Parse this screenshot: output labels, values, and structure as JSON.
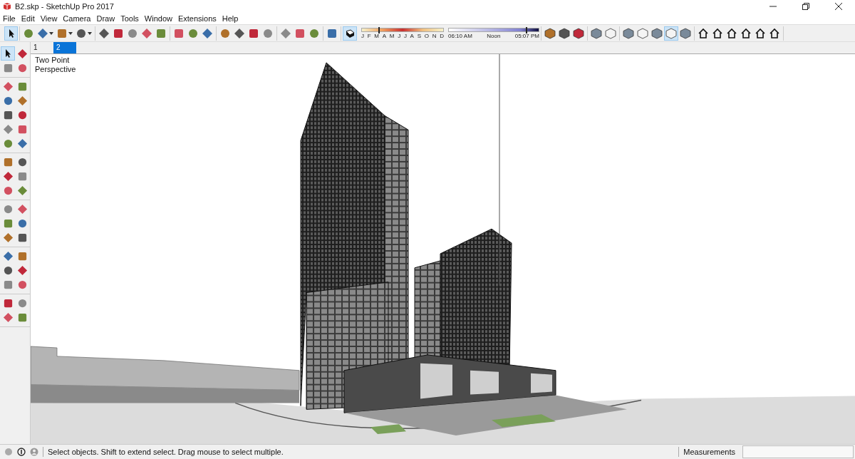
{
  "window": {
    "title": "B2.skp - SketchUp Pro 2017"
  },
  "menu": [
    "File",
    "Edit",
    "View",
    "Camera",
    "Draw",
    "Tools",
    "Window",
    "Extensions",
    "Help"
  ],
  "toolbar": {
    "groups_before": [
      [
        {
          "selected": true,
          "dropdown": false
        }
      ],
      [
        {
          "selected": false,
          "dropdown": false
        },
        {
          "selected": false,
          "dropdown": true
        },
        {
          "selected": false,
          "dropdown": true
        },
        {
          "selected": false,
          "dropdown": true
        }
      ],
      [
        {
          "selected": false,
          "dropdown": false
        },
        {
          "selected": false,
          "dropdown": false
        },
        {
          "selected": false,
          "dropdown": false
        },
        {
          "selected": false,
          "dropdown": false
        },
        {
          "selected": false,
          "dropdown": false
        }
      ],
      [
        {
          "selected": false,
          "dropdown": false
        },
        {
          "selected": false,
          "dropdown": false
        },
        {
          "selected": false,
          "dropdown": false
        }
      ],
      [
        {
          "selected": false,
          "dropdown": false
        },
        {
          "selected": false,
          "dropdown": false
        },
        {
          "selected": false,
          "dropdown": false
        },
        {
          "selected": false,
          "dropdown": false
        }
      ],
      [
        {
          "selected": false,
          "dropdown": false
        },
        {
          "selected": false,
          "dropdown": false
        },
        {
          "selected": false,
          "dropdown": false
        }
      ],
      [
        {
          "selected": false,
          "dropdown": false
        }
      ]
    ],
    "shadows": {
      "toggle": {
        "selected": true
      },
      "months": [
        "J",
        "F",
        "M",
        "A",
        "M",
        "J",
        "J",
        "A",
        "S",
        "O",
        "N",
        "D"
      ],
      "month_slider": {
        "level": 0.2
      },
      "times": [
        "06:10 AM",
        "Noon",
        "05:07 PM"
      ],
      "time_slider": {
        "level": 0.86
      }
    },
    "groups_after": [
      [
        {
          "selected": false,
          "dropdown": false
        },
        {
          "selected": false,
          "dropdown": false
        },
        {
          "selected": false,
          "dropdown": false
        }
      ],
      [
        {
          "selected": false,
          "dropdown": false
        },
        {
          "selected": false,
          "dropdown": false
        }
      ],
      [
        {
          "selected": false,
          "dropdown": false
        },
        {
          "selected": false,
          "dropdown": false
        },
        {
          "selected": false,
          "dropdown": false
        },
        {
          "selected": true,
          "dropdown": false
        },
        {
          "selected": false,
          "dropdown": false
        }
      ],
      [
        {
          "selected": false,
          "dropdown": false
        },
        {
          "selected": false,
          "dropdown": false
        },
        {
          "selected": false,
          "dropdown": false
        },
        {
          "selected": false,
          "dropdown": false
        },
        {
          "selected": false,
          "dropdown": false
        },
        {
          "selected": false,
          "dropdown": false
        }
      ]
    ]
  },
  "scenes": [
    {
      "label": "1",
      "selected": false
    },
    {
      "label": "2",
      "selected": true
    }
  ],
  "left_toolbar": {
    "groups": [
      [
        {
          "selected": true
        },
        {
          "selected": false
        },
        {
          "selected": false
        },
        {
          "selected": false
        }
      ],
      [
        {
          "selected": false
        },
        {
          "selected": false
        },
        {
          "selected": false
        },
        {
          "selected": false
        },
        {
          "selected": false
        },
        {
          "selected": false
        },
        {
          "selected": false
        },
        {
          "selected": false
        },
        {
          "selected": false
        },
        {
          "selected": false
        }
      ],
      [
        {
          "selected": false
        },
        {
          "selected": false
        },
        {
          "selected": false
        },
        {
          "selected": false
        },
        {
          "selected": false
        },
        {
          "selected": false
        }
      ],
      [
        {
          "selected": false
        },
        {
          "selected": false
        },
        {
          "selected": false
        },
        {
          "selected": false
        },
        {
          "selected": false
        },
        {
          "selected": false
        }
      ],
      [
        {
          "selected": false
        },
        {
          "selected": false
        },
        {
          "selected": false
        },
        {
          "selected": false
        },
        {
          "selected": false
        },
        {
          "selected": false
        }
      ],
      [
        {
          "selected": false
        },
        {
          "selected": false
        },
        {
          "selected": false
        },
        {
          "selected": false
        }
      ]
    ]
  },
  "viewport": {
    "camera_label": "Two Point Perspective"
  },
  "status_bar": {
    "message": "Select objects. Shift to extend select. Drag mouse to select multiple.",
    "measurements_label": "Measurements"
  }
}
